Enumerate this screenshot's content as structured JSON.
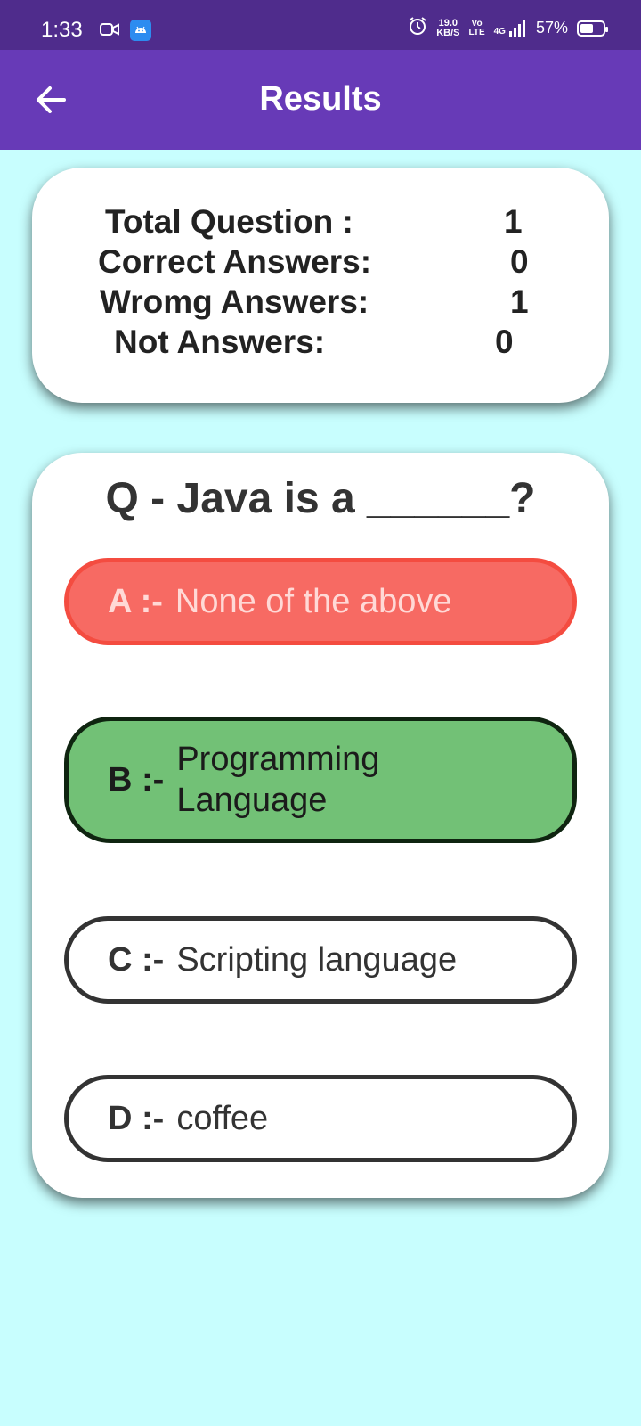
{
  "status_bar": {
    "time": "1:33",
    "speed_value": "19.0",
    "speed_unit": "KB/S",
    "volte_top": "Vo",
    "volte_bottom": "LTE",
    "network": "4G",
    "battery_pct": "57%",
    "battery_level": 0.57
  },
  "app_bar": {
    "title": "Results"
  },
  "summary": {
    "total_label": "Total Question :",
    "total_value": "1",
    "correct_label": "Correct Answers:",
    "correct_value": "0",
    "wrong_label": "Wromg Answers:",
    "wrong_value": "1",
    "not_label": "Not Answers:",
    "not_value": "0"
  },
  "question": {
    "text": "Q - Java is a ______?",
    "options": [
      {
        "letter": "A :-",
        "text": "None of the above",
        "state": "wrong"
      },
      {
        "letter": "B :-",
        "text": "Programming Language",
        "state": "correct"
      },
      {
        "letter": "C :-",
        "text": "Scripting language",
        "state": "neutral"
      },
      {
        "letter": "D :-",
        "text": "coffee",
        "state": "neutral"
      }
    ]
  },
  "colors": {
    "app_bar": "#673ab7",
    "status_bar": "#4f2c8c",
    "background": "#c8fefe",
    "wrong": "#f76a63",
    "correct": "#72c176"
  }
}
